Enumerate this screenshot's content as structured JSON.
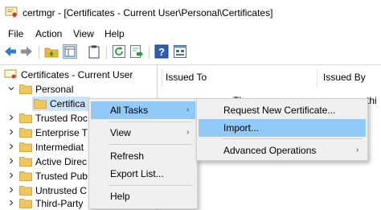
{
  "window": {
    "title": "certmgr - [Certificates - Current User\\Personal\\Certificates]"
  },
  "menubar": {
    "items": [
      "File",
      "Action",
      "View",
      "Help"
    ]
  },
  "toolbar": {
    "buttons": [
      "back-arrow-icon",
      "forward-arrow-icon",
      "up-folder-icon",
      "show-hide-tree-icon",
      "clipboard-icon",
      "refresh-icon",
      "export-icon",
      "help-icon",
      "properties-icon"
    ]
  },
  "tree": {
    "root": "Certificates - Current User",
    "personal": "Personal",
    "certificates": "Certifica",
    "items": [
      "Trusted Roc",
      "Enterprise T",
      "Intermediat",
      "Active Direc",
      "Trusted Pub",
      "Untrusted C",
      "Third-Party"
    ]
  },
  "list": {
    "columns": [
      "Issued To",
      "Issued By"
    ],
    "empty_text_fragment": "Th",
    "empty_text_fragment_2": "thi"
  },
  "context_menu": {
    "items": [
      "All Tasks",
      "View",
      "Refresh",
      "Export List...",
      "Help"
    ]
  },
  "submenu": {
    "items": [
      "Request New Certificate...",
      "Import...",
      "Advanced Operations"
    ]
  },
  "colors": {
    "highlight": "#91c9f7",
    "menu_bg": "#f0f0f0",
    "folder": "#e8b93a"
  }
}
